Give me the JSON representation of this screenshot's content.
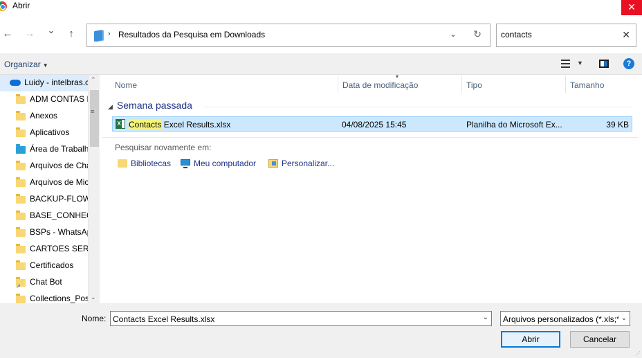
{
  "window": {
    "title": "Abrir",
    "close_glyph": "✕"
  },
  "nav": {
    "back_glyph": "←",
    "forward_glyph": "→",
    "recent_glyph": "⌄",
    "up_glyph": "↑",
    "address_separator": "›",
    "address_path": "Resultados da Pesquisa em Downloads",
    "address_dropdown_glyph": "⌄",
    "refresh_glyph": "↻",
    "search_value": "contacts",
    "search_clear_glyph": "✕"
  },
  "toolbar": {
    "organize_label": "Organizar",
    "organize_caret": "▼",
    "view_caret": "▼",
    "help_glyph": "?"
  },
  "sidebar": {
    "items": [
      {
        "label": "Luidy - intelbras.c",
        "icon": "onedrive-cloud-icon"
      },
      {
        "label": "ADM CONTAS E",
        "icon": "folder-icon"
      },
      {
        "label": "Anexos",
        "icon": "folder-icon"
      },
      {
        "label": "Aplicativos",
        "icon": "folder-icon"
      },
      {
        "label": "Área de Trabalho",
        "icon": "desktop-folder-icon"
      },
      {
        "label": "Arquivos de Cha",
        "icon": "folder-icon"
      },
      {
        "label": "Arquivos de Mic",
        "icon": "folder-icon"
      },
      {
        "label": "BACKUP-FLOWS",
        "icon": "folder-icon"
      },
      {
        "label": "BASE_CONHECI",
        "icon": "folder-icon"
      },
      {
        "label": "BSPs - WhatsAp",
        "icon": "folder-icon"
      },
      {
        "label": "CARTOES SERVIC",
        "icon": "folder-icon"
      },
      {
        "label": "Certificados",
        "icon": "folder-icon"
      },
      {
        "label": "Chat Bot",
        "icon": "shortcut-folder-icon"
      },
      {
        "label": "Collections_Pos",
        "icon": "folder-icon"
      }
    ],
    "scroll_up_glyph": "⌃",
    "scroll_down_glyph": "⌄",
    "scroll_grip_glyph": "≡"
  },
  "columns": {
    "name": "Nome",
    "modified": "Data de modificação",
    "type": "Tipo",
    "size": "Tamanho",
    "sort_glyph": "▾"
  },
  "group": {
    "caret": "◢",
    "label": "Semana passada"
  },
  "files": [
    {
      "name_highlight": "Contacts",
      "name_rest": " Excel Results.xlsx",
      "modified": "04/08/2025 15:45",
      "type": "Planilha do Microsoft Ex...",
      "size": "39 KB"
    }
  ],
  "search_again": {
    "label": "Pesquisar novamente em:",
    "locations": [
      "Bibliotecas",
      "Meu computador",
      "Personalizar..."
    ]
  },
  "footer": {
    "name_label": "Nome:",
    "name_value": "Contacts Excel Results.xlsx",
    "name_dropdown_glyph": "⌄",
    "type_filter": "Arquivos personalizados (*.xls;*",
    "type_dropdown_glyph": "⌄",
    "open_label": "Abrir",
    "cancel_label": "Cancelar",
    "resize_grip_glyph": "⋰"
  }
}
